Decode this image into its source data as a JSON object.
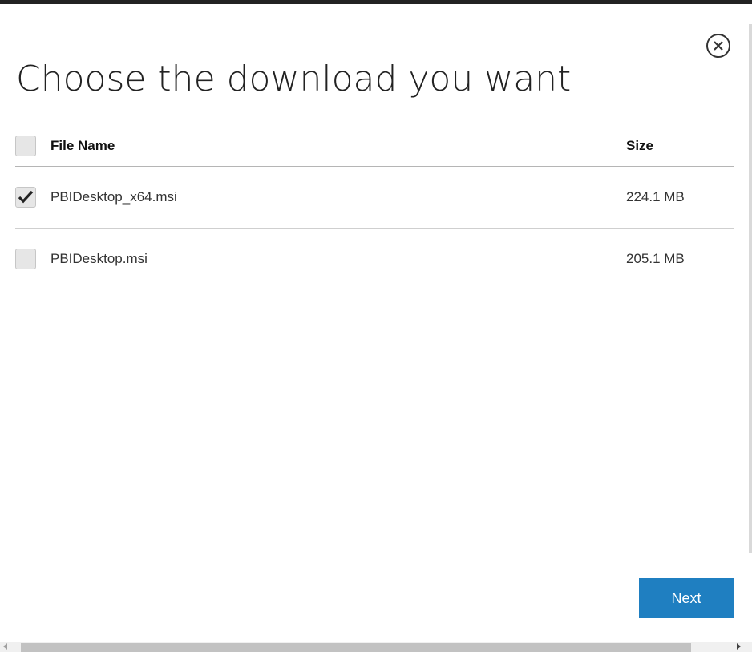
{
  "dialog": {
    "title": "Choose the download you want",
    "close_icon": "circle-x-icon"
  },
  "table": {
    "headers": {
      "file_name": "File Name",
      "size": "Size"
    },
    "select_all_checked": false,
    "rows": [
      {
        "file_name": "PBIDesktop_x64.msi",
        "size": "224.1 MB",
        "checked": true
      },
      {
        "file_name": "PBIDesktop.msi",
        "size": "205.1 MB",
        "checked": false
      }
    ]
  },
  "footer": {
    "next_label": "Next"
  },
  "colors": {
    "accent": "#1f7fc1",
    "top_bar": "#222222"
  }
}
